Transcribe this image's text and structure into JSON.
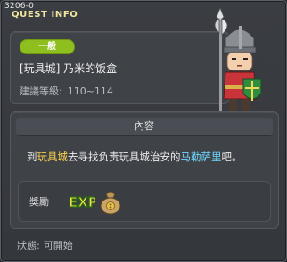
{
  "window": {
    "quest_id": "3206-0",
    "title": "QUEST INFO"
  },
  "quest": {
    "category": "一般",
    "name": "[玩具城] 乃米的饭盒",
    "level_label": "建議等級:",
    "level_range": "110~114"
  },
  "description": {
    "header": "內容",
    "part1": "到",
    "location": "玩具城",
    "part2": "去寻找负责玩具城治安的",
    "npc_name": "马勒萨里",
    "part3": "吧。"
  },
  "reward": {
    "label": "獎勵",
    "items": [
      "exp-icon",
      "money-bag-icon"
    ],
    "exp_text": "EXP"
  },
  "status": {
    "label": "狀態:",
    "value": "可開始"
  },
  "colors": {
    "badge": "#8fbf1f",
    "highlight_location": "#ffd54a",
    "highlight_npc": "#6fd6ff",
    "title": "#f1e7a0"
  }
}
